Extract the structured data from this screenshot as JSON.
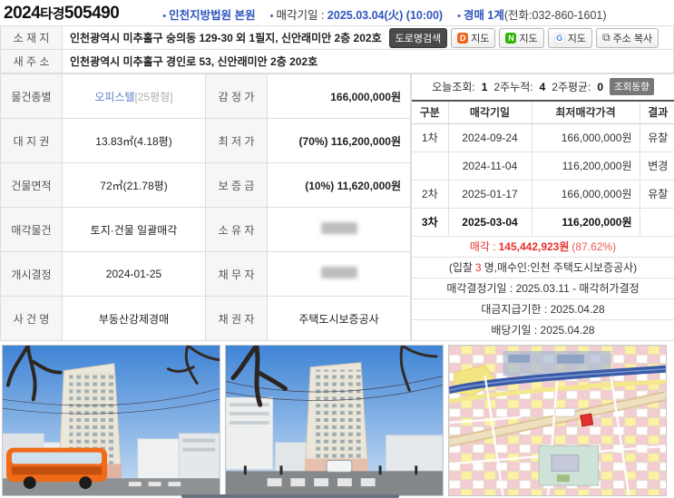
{
  "header": {
    "bullet": "•",
    "case_year": "2024",
    "case_type": "타경",
    "case_number": "505490",
    "court": "인천지방법원 본원",
    "sale_date_label": "매각기일 : ",
    "sale_date_value": "2025.03.04(火) (10:00)",
    "dept": "경매 1계",
    "dept_phone": "(전화:032-860-1601)"
  },
  "address": {
    "location_label": "소 재 지",
    "location_value": "인천광역시 미추홀구 숭의동 129-30 외 1필지, 신안래미안 2층 202호",
    "road_label": "새 주 소",
    "road_value": "인천광역시 미추홀구 경인로 53, 신안래미안 2층 202호",
    "buttons": {
      "road_search": "도로명검색",
      "daum_icon": "D",
      "daum": "지도",
      "naver_icon": "N",
      "naver": "지도",
      "google_icon": "G",
      "google": "지도",
      "copy_icon": "⧉",
      "copy": "주소 복사"
    }
  },
  "details": {
    "rows": [
      {
        "label1": "물건종별",
        "value1_link": "오피스텔",
        "value1_sub": "[25평형]",
        "label2": "감 정 가",
        "value2": "166,000,000원"
      },
      {
        "label1": "대 지 권",
        "value1": "13.83㎡(4.18평)",
        "label2": "최 저 가",
        "value2": "(70%) 116,200,000원"
      },
      {
        "label1": "건물면적",
        "value1": "72㎡(21.78평)",
        "label2": "보 증 금",
        "value2": "(10%) 11,620,000원"
      },
      {
        "label1": "매각물건",
        "value1": "토지·건물 일괄매각",
        "label2": "소 유 자",
        "value2": ""
      },
      {
        "label1": "개시결정",
        "value1": "2024-01-25",
        "label2": "채 무 자",
        "value2": ""
      },
      {
        "label1": "사 건 명",
        "value1": "부동산강제경매",
        "label2": "채 권 자",
        "value2": "주택도시보증공사"
      }
    ]
  },
  "views": {
    "today_label": "오늘조회:",
    "today": "1",
    "two_week_label": "2주누적:",
    "two_week": "4",
    "avg_label": "2주평균:",
    "avg": "0",
    "trend_button": "조회동향"
  },
  "history": {
    "headers": {
      "round": "구분",
      "date": "매각기일",
      "price": "최저매각가격",
      "result": "결과"
    },
    "rows": [
      {
        "round": "1차",
        "date": "2024-09-24",
        "price": "166,000,000원",
        "result": "유찰"
      },
      {
        "round": "",
        "date": "2024-11-04",
        "price": "116,200,000원",
        "result": "변경"
      },
      {
        "round": "2차",
        "date": "2025-01-17",
        "price": "166,000,000원",
        "result": "유찰"
      },
      {
        "round": "3차",
        "date": "2025-03-04",
        "price": "116,200,000원",
        "result": ""
      }
    ]
  },
  "result": {
    "sale_label": "매각 : ",
    "sale_price": "145,442,923원",
    "sale_percent": "(87.62%)",
    "bidders_pre": "(입찰",
    "bidders_count": "3",
    "bidders_post": "명,매수인:인천 주택도시보증공사)",
    "decision": "매각결정기일 : 2025.03.11 - 매각허가결정",
    "payment_due": "대금지급기한 : 2025.04.28",
    "dividend": "배당기일 : 2025.04.28"
  },
  "photos": {
    "items": [
      "building-exterior-photo-1",
      "building-exterior-photo-2",
      "cadastral-map-thumbnail"
    ]
  },
  "colors": {
    "accent_blue": "#2f55c0",
    "link_blue": "#5b7fd0",
    "alert_red": "#e8302a"
  }
}
